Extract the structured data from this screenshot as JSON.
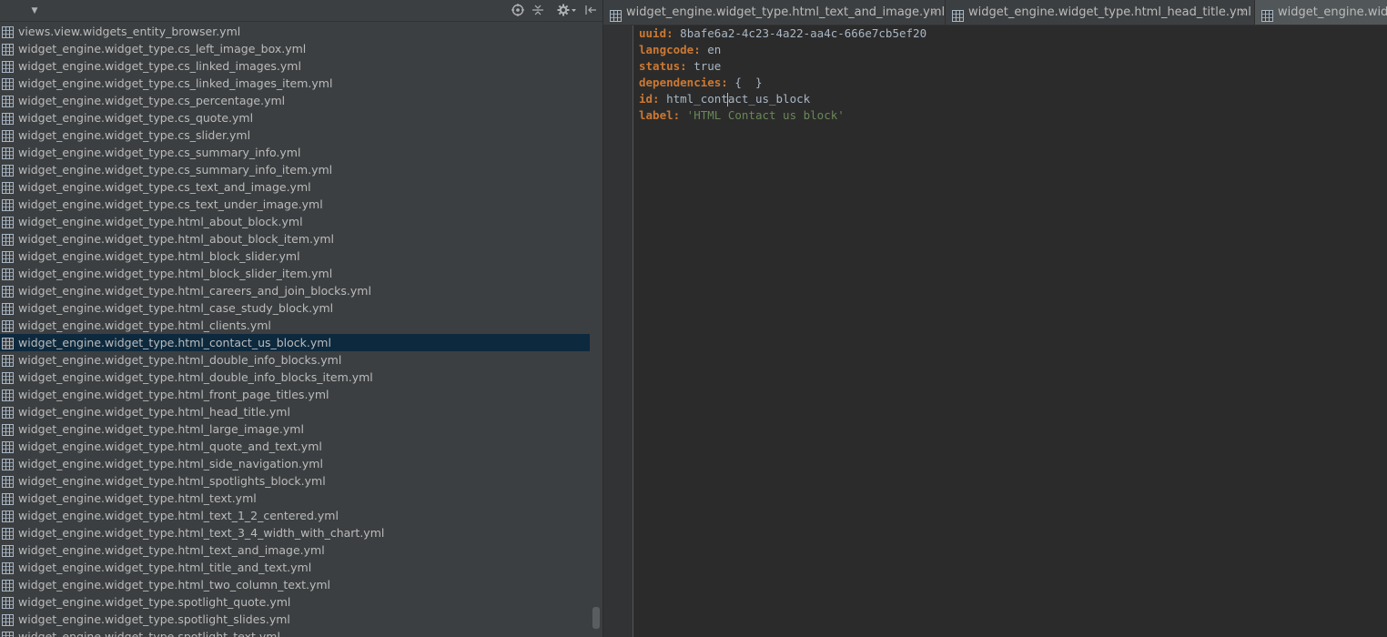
{
  "project_panel": {
    "files": [
      "views.view.widgets_entity_browser.yml",
      "widget_engine.widget_type.cs_left_image_box.yml",
      "widget_engine.widget_type.cs_linked_images.yml",
      "widget_engine.widget_type.cs_linked_images_item.yml",
      "widget_engine.widget_type.cs_percentage.yml",
      "widget_engine.widget_type.cs_quote.yml",
      "widget_engine.widget_type.cs_slider.yml",
      "widget_engine.widget_type.cs_summary_info.yml",
      "widget_engine.widget_type.cs_summary_info_item.yml",
      "widget_engine.widget_type.cs_text_and_image.yml",
      "widget_engine.widget_type.cs_text_under_image.yml",
      "widget_engine.widget_type.html_about_block.yml",
      "widget_engine.widget_type.html_about_block_item.yml",
      "widget_engine.widget_type.html_block_slider.yml",
      "widget_engine.widget_type.html_block_slider_item.yml",
      "widget_engine.widget_type.html_careers_and_join_blocks.yml",
      "widget_engine.widget_type.html_case_study_block.yml",
      "widget_engine.widget_type.html_clients.yml",
      "widget_engine.widget_type.html_contact_us_block.yml",
      "widget_engine.widget_type.html_double_info_blocks.yml",
      "widget_engine.widget_type.html_double_info_blocks_item.yml",
      "widget_engine.widget_type.html_front_page_titles.yml",
      "widget_engine.widget_type.html_head_title.yml",
      "widget_engine.widget_type.html_large_image.yml",
      "widget_engine.widget_type.html_quote_and_text.yml",
      "widget_engine.widget_type.html_side_navigation.yml",
      "widget_engine.widget_type.html_spotlights_block.yml",
      "widget_engine.widget_type.html_text.yml",
      "widget_engine.widget_type.html_text_1_2_centered.yml",
      "widget_engine.widget_type.html_text_3_4_width_with_chart.yml",
      "widget_engine.widget_type.html_text_and_image.yml",
      "widget_engine.widget_type.html_title_and_text.yml",
      "widget_engine.widget_type.html_two_column_text.yml",
      "widget_engine.widget_type.spotlight_quote.yml",
      "widget_engine.widget_type.spotlight_slides.yml",
      "widget_engine.widget_type.spotlight_text.yml"
    ],
    "selected_file": "widget_engine.widget_type.html_contact_us_block.yml",
    "toolbar_icons": [
      "dropdown-arrow-icon",
      "locate-icon",
      "collapse-all-icon",
      "settings-icon",
      "hide-panel-icon"
    ]
  },
  "tabs": [
    {
      "label": "widget_engine.widget_type.html_text_and_image.yml",
      "close": "×",
      "active": false
    },
    {
      "label": "widget_engine.widget_type.html_head_title.yml",
      "close": "×",
      "active": false
    },
    {
      "label": "widget_engine.widg",
      "close": "",
      "active": true
    }
  ],
  "editor": {
    "lines": [
      {
        "key": "uuid:",
        "value": " 8bafe6a2-4c23-4a22-aa4c-666e7cb5ef20",
        "string": false
      },
      {
        "key": "langcode:",
        "value": " en",
        "string": false
      },
      {
        "key": "status:",
        "value": " true",
        "string": false
      },
      {
        "key": "dependencies:",
        "value": " {  }",
        "string": false
      },
      {
        "key": "id:",
        "value": " html_contact_us_block",
        "string": false,
        "caret_after": 10
      },
      {
        "key": "label:",
        "value": " 'HTML Contact us block'",
        "string": true
      }
    ]
  },
  "colors": {
    "panel_bg": "#3c3f41",
    "editor_bg": "#2b2b2b",
    "selection": "#0d293e",
    "keyword": "#cc7832",
    "string": "#6a8759",
    "text": "#a9b7c6"
  }
}
